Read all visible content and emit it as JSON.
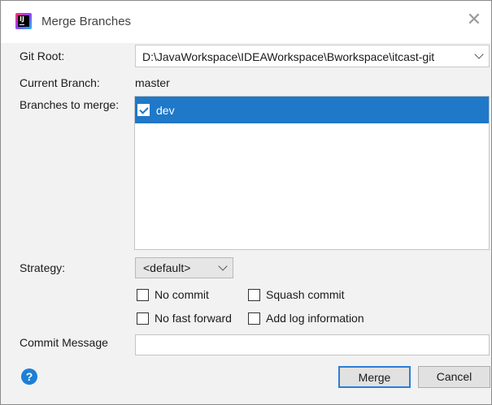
{
  "window": {
    "title": "Merge Branches"
  },
  "git_root": {
    "label": "Git Root:",
    "value": "D:\\JavaWorkspace\\IDEAWorkspace\\Bworkspace\\itcast-git"
  },
  "current_branch": {
    "label": "Current Branch:",
    "value": "master"
  },
  "branches": {
    "label": "Branches to merge:",
    "items": [
      {
        "name": "dev",
        "checked": true,
        "selected": true
      }
    ]
  },
  "strategy": {
    "label": "Strategy:",
    "value": "<default>"
  },
  "options": {
    "no_commit": "No commit",
    "squash_commit": "Squash commit",
    "no_fast_forward": "No fast forward",
    "add_log_information": "Add log information"
  },
  "commit_message": {
    "label": "Commit Message",
    "value": ""
  },
  "buttons": {
    "help": "?",
    "merge": "Merge",
    "cancel": "Cancel"
  },
  "colors": {
    "selection": "#1f78c8",
    "help": "#1d7fd6",
    "default_button_border": "#2d7ed6"
  }
}
